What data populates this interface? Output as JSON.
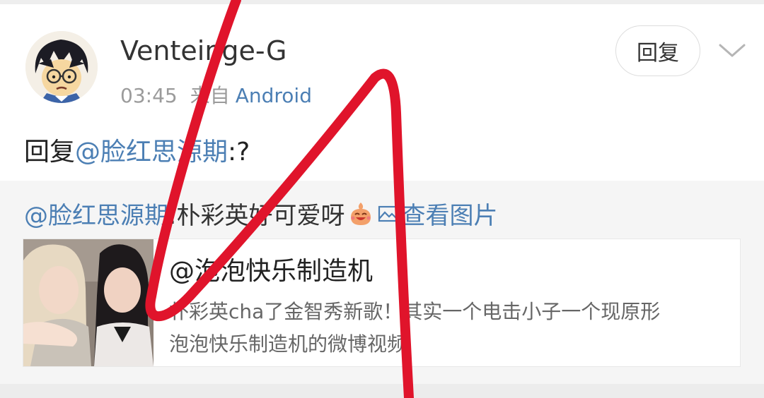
{
  "post": {
    "username": "Venteinge-G",
    "time": "03:45",
    "from_label": "来自",
    "device": "Android",
    "reply_button": "回复",
    "comment_prefix": "回复",
    "comment_mention": "@脸红思源期",
    "comment_suffix": ":?"
  },
  "quote": {
    "mention": "@脸红思源期",
    "text": ":朴彩英好可爱呀",
    "emoji_icon": "laughing-face-emoji-icon",
    "image_link": "查看图片",
    "embed": {
      "title": "@泡泡快乐制造机",
      "desc_line1": "朴彩英cha了金智秀新歌！其实一个电击小子一个现原形",
      "desc_line2": "泡泡快乐制造机的微博视频"
    }
  },
  "colors": {
    "link": "#4c7fb4",
    "annotation": "#e0142b"
  }
}
